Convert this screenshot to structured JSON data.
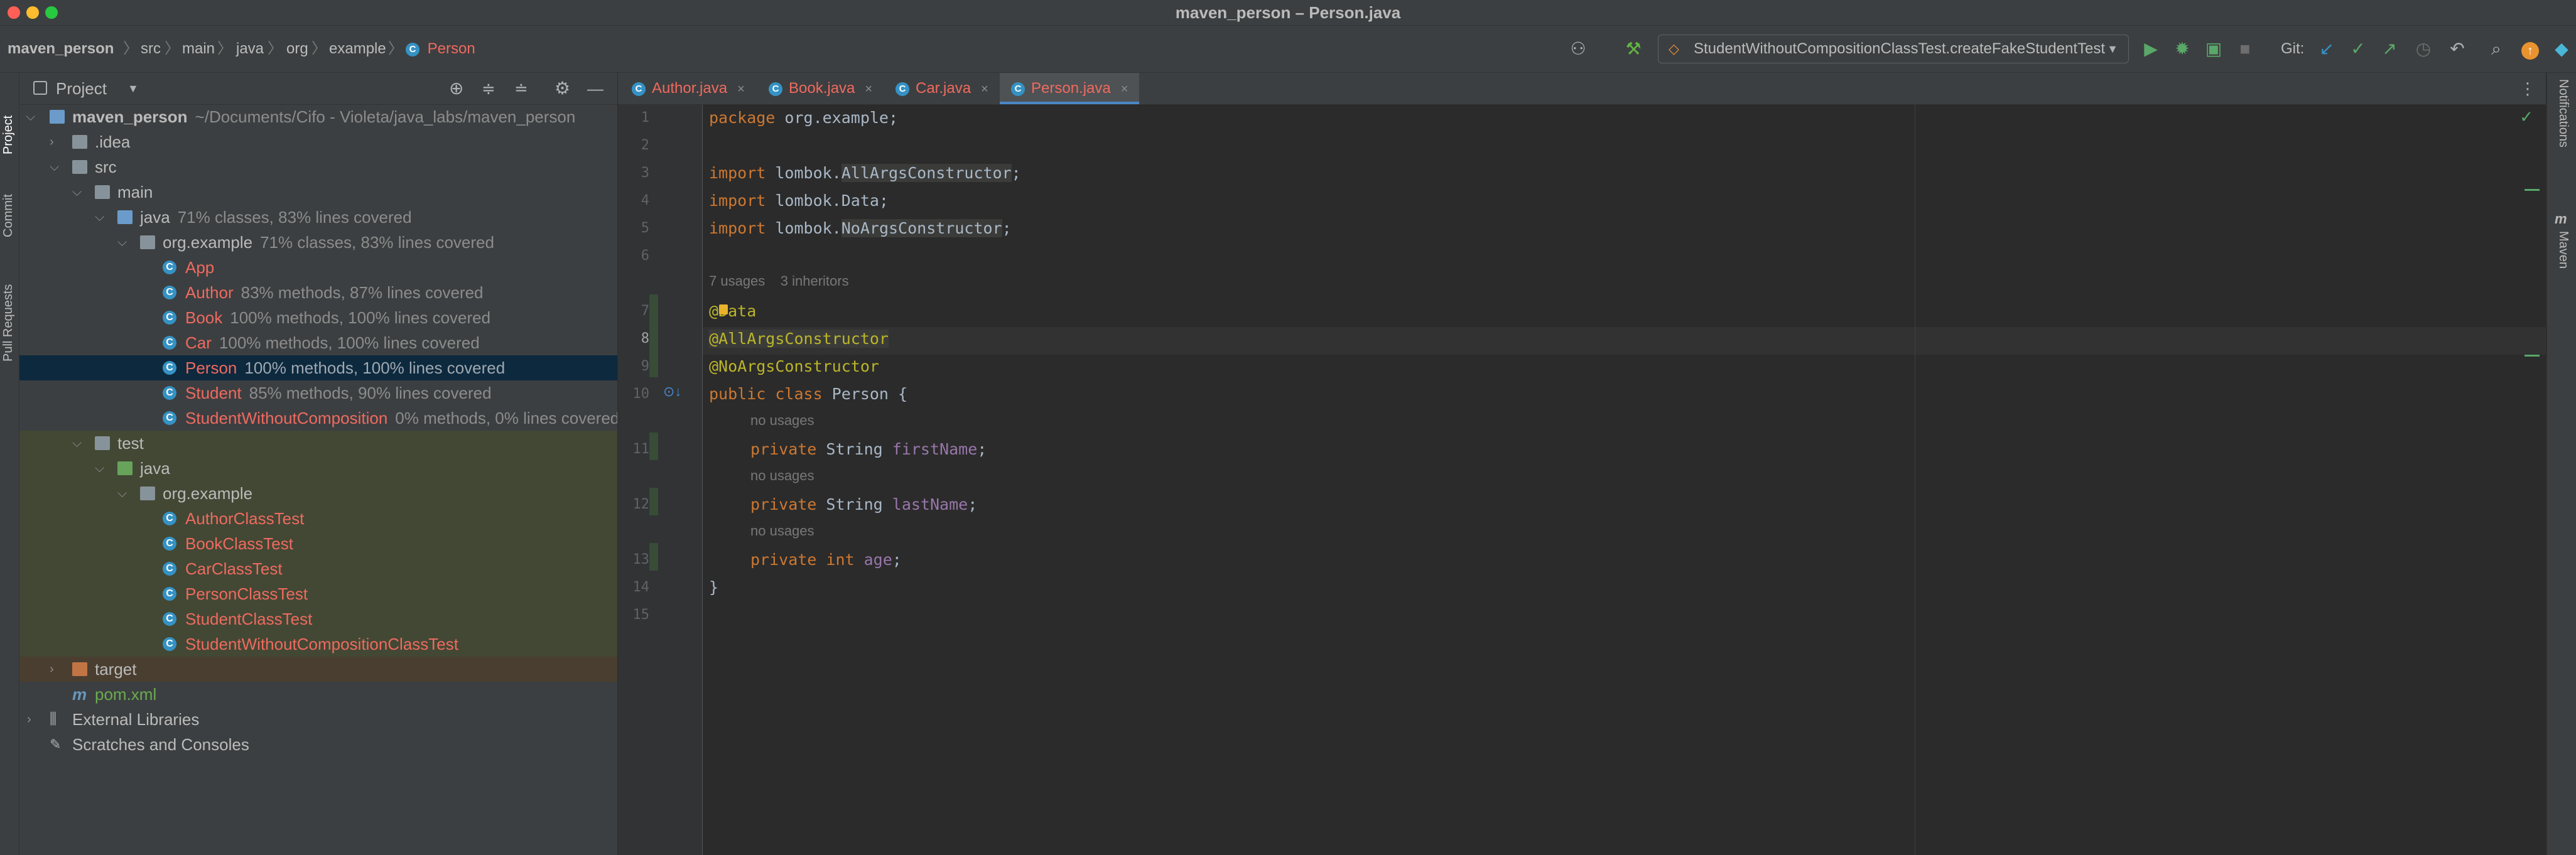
{
  "window": {
    "title": "maven_person – Person.java",
    "traffic_colors": [
      "#ff5f57",
      "#febc2e",
      "#28c840"
    ]
  },
  "breadcrumbs": [
    "maven_person",
    "src",
    "main",
    "java",
    "org",
    "example",
    "Person"
  ],
  "toolbar": {
    "run_config": "StudentWithoutCompositionClassTest.createFakeStudentTest",
    "git_label": "Git:",
    "icons": [
      "user-icon",
      "hammer-icon",
      "run-icon",
      "debug-icon",
      "coverage-icon",
      "stop-icon",
      "git-update-icon",
      "git-commit-icon",
      "git-push-icon",
      "history-icon",
      "rollback-icon",
      "search-icon",
      "update-icon",
      "plugin-icon"
    ]
  },
  "left_strip": {
    "project": "Project",
    "commit": "Commit",
    "pull_requests": "Pull Requests"
  },
  "right_strip": {
    "notifications": "Notifications",
    "maven": "Maven"
  },
  "project_panel": {
    "title": "Project",
    "tree": [
      {
        "name": "maven_person",
        "extra": "~/Documents/Cifo - Violeta/java_labs/maven_person",
        "kind": "module",
        "depth": 0,
        "expanded": true
      },
      {
        "name": ".idea",
        "kind": "folder",
        "depth": 1,
        "expanded": false
      },
      {
        "name": "src",
        "kind": "folder",
        "depth": 1,
        "expanded": true
      },
      {
        "name": "main",
        "kind": "folder",
        "depth": 2,
        "expanded": true
      },
      {
        "name": "java",
        "coverage": "71% classes, 83% lines covered",
        "kind": "source-folder",
        "depth": 3,
        "expanded": true
      },
      {
        "name": "org.example",
        "coverage": "71% classes, 83% lines covered",
        "kind": "package",
        "depth": 4,
        "expanded": true
      },
      {
        "name": "App",
        "kind": "class",
        "depth": 5
      },
      {
        "name": "Author",
        "coverage": "83% methods, 87% lines covered",
        "kind": "class",
        "depth": 5
      },
      {
        "name": "Book",
        "coverage": "100% methods, 100% lines covered",
        "kind": "class",
        "depth": 5
      },
      {
        "name": "Car",
        "coverage": "100% methods, 100% lines covered",
        "kind": "class",
        "depth": 5
      },
      {
        "name": "Person",
        "coverage": "100% methods, 100% lines covered",
        "kind": "class",
        "depth": 5,
        "selected": true
      },
      {
        "name": "Student",
        "coverage": "85% methods, 90% lines covered",
        "kind": "class",
        "depth": 5
      },
      {
        "name": "StudentWithoutComposition",
        "coverage": "0% methods, 0% lines covered",
        "kind": "class",
        "depth": 5
      },
      {
        "name": "test",
        "kind": "folder",
        "depth": 2,
        "expanded": true
      },
      {
        "name": "java",
        "kind": "test-folder",
        "depth": 3,
        "expanded": true
      },
      {
        "name": "org.example",
        "kind": "package",
        "depth": 4,
        "expanded": true
      },
      {
        "name": "AuthorClassTest",
        "kind": "test-class",
        "depth": 5
      },
      {
        "name": "BookClassTest",
        "kind": "test-class",
        "depth": 5
      },
      {
        "name": "CarClassTest",
        "kind": "test-class",
        "depth": 5
      },
      {
        "name": "PersonClassTest",
        "kind": "test-class",
        "depth": 5
      },
      {
        "name": "StudentClassTest",
        "kind": "test-class",
        "depth": 5
      },
      {
        "name": "StudentWithoutCompositionClassTest",
        "kind": "test-class",
        "depth": 5
      },
      {
        "name": "target",
        "kind": "excluded-folder",
        "depth": 1,
        "expanded": false
      },
      {
        "name": "pom.xml",
        "kind": "maven-file",
        "depth": 1
      },
      {
        "name": "External Libraries",
        "kind": "libraries",
        "depth": 0,
        "expanded": false
      },
      {
        "name": "Scratches and Consoles",
        "kind": "scratches",
        "depth": 0
      }
    ]
  },
  "editor": {
    "tabs": [
      {
        "label": "Author.java",
        "active": false
      },
      {
        "label": "Book.java",
        "active": false
      },
      {
        "label": "Car.java",
        "active": false
      },
      {
        "label": "Person.java",
        "active": true
      }
    ],
    "usage_hint": "7 usages",
    "inheritors_hint": "3 inheritors",
    "no_usages": "no usages",
    "line_numbers": [
      "1",
      "2",
      "3",
      "4",
      "5",
      "6",
      "7",
      "8",
      "9",
      "10",
      "11",
      "12",
      "13",
      "14",
      "15"
    ],
    "code": {
      "l1_kw": "package",
      "l1_rest": " org.example;",
      "l3_kw": "import",
      "l3_pkg": " lombok.",
      "l3_cls": "AllArgsConstructor",
      "l3_end": ";",
      "l4_kw": "import",
      "l4_rest": " lombok.Data;",
      "l5_kw": "import",
      "l5_pkg": " lombok.",
      "l5_cls": "NoArgsConstructor",
      "l5_end": ";",
      "l7": "@Data",
      "l8": "@AllArgsConstructor",
      "l9": "@NoArgsConstructor",
      "l10_kw": "public class",
      "l10_rest": " Person {",
      "l11_kw": "private",
      "l11_type": " String ",
      "l11_field": "firstName",
      "l11_end": ";",
      "l12_kw": "private",
      "l12_type": " String ",
      "l12_field": "lastName",
      "l12_end": ";",
      "l13_kw": "private int",
      "l13_field": " age",
      "l13_end": ";",
      "l14": "}"
    }
  }
}
